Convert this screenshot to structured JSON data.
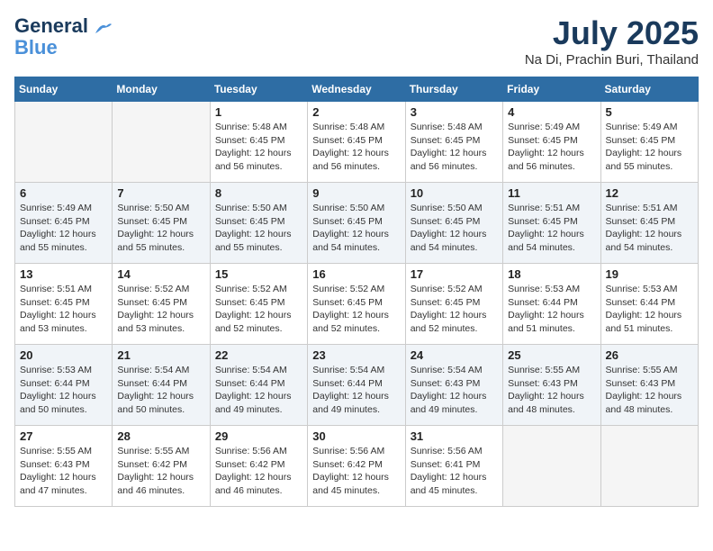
{
  "header": {
    "logo_line1": "General",
    "logo_line2": "Blue",
    "month_title": "July 2025",
    "location": "Na Di, Prachin Buri, Thailand"
  },
  "weekdays": [
    "Sunday",
    "Monday",
    "Tuesday",
    "Wednesday",
    "Thursday",
    "Friday",
    "Saturday"
  ],
  "weeks": [
    [
      {
        "day": "",
        "detail": ""
      },
      {
        "day": "",
        "detail": ""
      },
      {
        "day": "1",
        "detail": "Sunrise: 5:48 AM\nSunset: 6:45 PM\nDaylight: 12 hours and 56 minutes."
      },
      {
        "day": "2",
        "detail": "Sunrise: 5:48 AM\nSunset: 6:45 PM\nDaylight: 12 hours and 56 minutes."
      },
      {
        "day": "3",
        "detail": "Sunrise: 5:48 AM\nSunset: 6:45 PM\nDaylight: 12 hours and 56 minutes."
      },
      {
        "day": "4",
        "detail": "Sunrise: 5:49 AM\nSunset: 6:45 PM\nDaylight: 12 hours and 56 minutes."
      },
      {
        "day": "5",
        "detail": "Sunrise: 5:49 AM\nSunset: 6:45 PM\nDaylight: 12 hours and 55 minutes."
      }
    ],
    [
      {
        "day": "6",
        "detail": "Sunrise: 5:49 AM\nSunset: 6:45 PM\nDaylight: 12 hours and 55 minutes."
      },
      {
        "day": "7",
        "detail": "Sunrise: 5:50 AM\nSunset: 6:45 PM\nDaylight: 12 hours and 55 minutes."
      },
      {
        "day": "8",
        "detail": "Sunrise: 5:50 AM\nSunset: 6:45 PM\nDaylight: 12 hours and 55 minutes."
      },
      {
        "day": "9",
        "detail": "Sunrise: 5:50 AM\nSunset: 6:45 PM\nDaylight: 12 hours and 54 minutes."
      },
      {
        "day": "10",
        "detail": "Sunrise: 5:50 AM\nSunset: 6:45 PM\nDaylight: 12 hours and 54 minutes."
      },
      {
        "day": "11",
        "detail": "Sunrise: 5:51 AM\nSunset: 6:45 PM\nDaylight: 12 hours and 54 minutes."
      },
      {
        "day": "12",
        "detail": "Sunrise: 5:51 AM\nSunset: 6:45 PM\nDaylight: 12 hours and 54 minutes."
      }
    ],
    [
      {
        "day": "13",
        "detail": "Sunrise: 5:51 AM\nSunset: 6:45 PM\nDaylight: 12 hours and 53 minutes."
      },
      {
        "day": "14",
        "detail": "Sunrise: 5:52 AM\nSunset: 6:45 PM\nDaylight: 12 hours and 53 minutes."
      },
      {
        "day": "15",
        "detail": "Sunrise: 5:52 AM\nSunset: 6:45 PM\nDaylight: 12 hours and 52 minutes."
      },
      {
        "day": "16",
        "detail": "Sunrise: 5:52 AM\nSunset: 6:45 PM\nDaylight: 12 hours and 52 minutes."
      },
      {
        "day": "17",
        "detail": "Sunrise: 5:52 AM\nSunset: 6:45 PM\nDaylight: 12 hours and 52 minutes."
      },
      {
        "day": "18",
        "detail": "Sunrise: 5:53 AM\nSunset: 6:44 PM\nDaylight: 12 hours and 51 minutes."
      },
      {
        "day": "19",
        "detail": "Sunrise: 5:53 AM\nSunset: 6:44 PM\nDaylight: 12 hours and 51 minutes."
      }
    ],
    [
      {
        "day": "20",
        "detail": "Sunrise: 5:53 AM\nSunset: 6:44 PM\nDaylight: 12 hours and 50 minutes."
      },
      {
        "day": "21",
        "detail": "Sunrise: 5:54 AM\nSunset: 6:44 PM\nDaylight: 12 hours and 50 minutes."
      },
      {
        "day": "22",
        "detail": "Sunrise: 5:54 AM\nSunset: 6:44 PM\nDaylight: 12 hours and 49 minutes."
      },
      {
        "day": "23",
        "detail": "Sunrise: 5:54 AM\nSunset: 6:44 PM\nDaylight: 12 hours and 49 minutes."
      },
      {
        "day": "24",
        "detail": "Sunrise: 5:54 AM\nSunset: 6:43 PM\nDaylight: 12 hours and 49 minutes."
      },
      {
        "day": "25",
        "detail": "Sunrise: 5:55 AM\nSunset: 6:43 PM\nDaylight: 12 hours and 48 minutes."
      },
      {
        "day": "26",
        "detail": "Sunrise: 5:55 AM\nSunset: 6:43 PM\nDaylight: 12 hours and 48 minutes."
      }
    ],
    [
      {
        "day": "27",
        "detail": "Sunrise: 5:55 AM\nSunset: 6:43 PM\nDaylight: 12 hours and 47 minutes."
      },
      {
        "day": "28",
        "detail": "Sunrise: 5:55 AM\nSunset: 6:42 PM\nDaylight: 12 hours and 46 minutes."
      },
      {
        "day": "29",
        "detail": "Sunrise: 5:56 AM\nSunset: 6:42 PM\nDaylight: 12 hours and 46 minutes."
      },
      {
        "day": "30",
        "detail": "Sunrise: 5:56 AM\nSunset: 6:42 PM\nDaylight: 12 hours and 45 minutes."
      },
      {
        "day": "31",
        "detail": "Sunrise: 5:56 AM\nSunset: 6:41 PM\nDaylight: 12 hours and 45 minutes."
      },
      {
        "day": "",
        "detail": ""
      },
      {
        "day": "",
        "detail": ""
      }
    ]
  ]
}
